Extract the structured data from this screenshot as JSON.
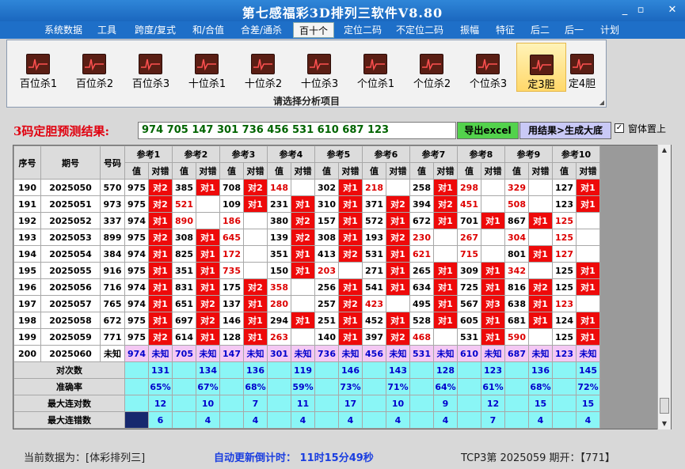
{
  "app": {
    "title": "第七感福彩3D排列三软件V8.80",
    "win_buttons": [
      "_",
      "▫",
      "✕"
    ]
  },
  "menu": {
    "items": [
      "系统数据",
      "工具",
      "跨度/复式",
      "和/合值",
      "合差/通杀",
      "百十个",
      "定位二码",
      "不定位二码",
      "振幅",
      "特征",
      "后二",
      "后一",
      "计划"
    ],
    "selected": "百十个"
  },
  "ribbon": {
    "buttons": [
      "百位杀1",
      "百位杀2",
      "百位杀3",
      "十位杀1",
      "十位杀2",
      "十位杀3",
      "个位杀1",
      "个位杀2",
      "个位杀3",
      "定3胆",
      "定4胆"
    ],
    "selected": "定3胆",
    "footer": "请选择分析项目"
  },
  "prediction": {
    "label": "3码定胆预测结果:",
    "value": "974 705 147 301 736 456 531 610 687 123",
    "excel_btn": "导出excel",
    "enlarge_btn": "用结果>生成大底",
    "topmost_label": "窗体置上",
    "topmost_check": "✓"
  },
  "grid": {
    "h_seq": "序号",
    "h_issue": "期号",
    "h_code": "号码",
    "refs": [
      "参考1",
      "参考2",
      "参考3",
      "参考4",
      "参考5",
      "参考6",
      "参考7",
      "参考8",
      "参考9",
      "参考10"
    ],
    "sub_val": "值",
    "sub_res": "对错",
    "rows": [
      {
        "seq": "190",
        "issue": "2025050",
        "code": "570",
        "cells": [
          [
            "975",
            "对2",
            1,
            0
          ],
          [
            "385",
            "对1",
            1,
            0
          ],
          [
            "708",
            "对2",
            1,
            0
          ],
          [
            "148",
            "",
            0,
            1
          ],
          [
            "302",
            "对1",
            1,
            0
          ],
          [
            "218",
            "",
            0,
            1
          ],
          [
            "258",
            "对1",
            1,
            0
          ],
          [
            "298",
            "",
            0,
            1
          ],
          [
            "329",
            "",
            0,
            1
          ],
          [
            "127",
            "对1",
            1,
            0
          ]
        ]
      },
      {
        "seq": "191",
        "issue": "2025051",
        "code": "973",
        "cells": [
          [
            "975",
            "对2",
            1,
            0
          ],
          [
            "521",
            "",
            0,
            1
          ],
          [
            "109",
            "对1",
            1,
            0
          ],
          [
            "231",
            "对1",
            1,
            0
          ],
          [
            "310",
            "对1",
            1,
            0
          ],
          [
            "371",
            "对2",
            1,
            0
          ],
          [
            "394",
            "对2",
            1,
            0
          ],
          [
            "451",
            "",
            0,
            1
          ],
          [
            "508",
            "",
            0,
            1
          ],
          [
            "123",
            "对1",
            1,
            0
          ]
        ]
      },
      {
        "seq": "192",
        "issue": "2025052",
        "code": "337",
        "cells": [
          [
            "974",
            "对1",
            1,
            0
          ],
          [
            "890",
            "",
            0,
            1
          ],
          [
            "186",
            "",
            0,
            1
          ],
          [
            "380",
            "对2",
            1,
            0
          ],
          [
            "157",
            "对1",
            1,
            0
          ],
          [
            "572",
            "对1",
            1,
            0
          ],
          [
            "672",
            "对1",
            1,
            0
          ],
          [
            "701",
            "对1",
            1,
            0
          ],
          [
            "867",
            "对1",
            1,
            0
          ],
          [
            "125",
            "",
            0,
            1
          ]
        ]
      },
      {
        "seq": "193",
        "issue": "2025053",
        "code": "899",
        "cells": [
          [
            "975",
            "对2",
            1,
            0
          ],
          [
            "308",
            "对1",
            1,
            0
          ],
          [
            "645",
            "",
            0,
            1
          ],
          [
            "139",
            "对2",
            1,
            0
          ],
          [
            "308",
            "对1",
            1,
            0
          ],
          [
            "193",
            "对2",
            1,
            0
          ],
          [
            "230",
            "",
            0,
            1
          ],
          [
            "267",
            "",
            0,
            1
          ],
          [
            "304",
            "",
            0,
            1
          ],
          [
            "125",
            "",
            0,
            1
          ]
        ]
      },
      {
        "seq": "194",
        "issue": "2025054",
        "code": "384",
        "cells": [
          [
            "974",
            "对1",
            1,
            0
          ],
          [
            "825",
            "对1",
            1,
            0
          ],
          [
            "172",
            "",
            0,
            1
          ],
          [
            "351",
            "对1",
            1,
            0
          ],
          [
            "413",
            "对2",
            1,
            0
          ],
          [
            "531",
            "对1",
            1,
            0
          ],
          [
            "621",
            "",
            0,
            1
          ],
          [
            "715",
            "",
            0,
            1
          ],
          [
            "801",
            "对1",
            1,
            0
          ],
          [
            "127",
            "",
            0,
            1
          ]
        ]
      },
      {
        "seq": "195",
        "issue": "2025055",
        "code": "916",
        "cells": [
          [
            "975",
            "对1",
            1,
            0
          ],
          [
            "351",
            "对1",
            1,
            0
          ],
          [
            "735",
            "",
            0,
            1
          ],
          [
            "150",
            "对1",
            1,
            0
          ],
          [
            "203",
            "",
            0,
            1
          ],
          [
            "271",
            "对1",
            1,
            0
          ],
          [
            "265",
            "对1",
            1,
            0
          ],
          [
            "309",
            "对1",
            1,
            0
          ],
          [
            "342",
            "",
            0,
            1
          ],
          [
            "125",
            "对1",
            1,
            0
          ]
        ]
      },
      {
        "seq": "196",
        "issue": "2025056",
        "code": "716",
        "cells": [
          [
            "974",
            "对1",
            1,
            0
          ],
          [
            "831",
            "对1",
            1,
            0
          ],
          [
            "175",
            "对2",
            1,
            0
          ],
          [
            "358",
            "",
            0,
            1
          ],
          [
            "256",
            "对1",
            1,
            0
          ],
          [
            "541",
            "对1",
            1,
            0
          ],
          [
            "634",
            "对1",
            1,
            0
          ],
          [
            "725",
            "对1",
            1,
            0
          ],
          [
            "816",
            "对2",
            1,
            0
          ],
          [
            "125",
            "对1",
            1,
            0
          ]
        ]
      },
      {
        "seq": "197",
        "issue": "2025057",
        "code": "765",
        "cells": [
          [
            "974",
            "对1",
            1,
            0
          ],
          [
            "651",
            "对2",
            1,
            0
          ],
          [
            "137",
            "对1",
            1,
            0
          ],
          [
            "280",
            "",
            0,
            1
          ],
          [
            "257",
            "对2",
            1,
            0
          ],
          [
            "423",
            "",
            0,
            1
          ],
          [
            "495",
            "对1",
            1,
            0
          ],
          [
            "567",
            "对3",
            1,
            0
          ],
          [
            "638",
            "对1",
            1,
            0
          ],
          [
            "123",
            "",
            0,
            1
          ]
        ]
      },
      {
        "seq": "198",
        "issue": "2025058",
        "code": "672",
        "cells": [
          [
            "975",
            "对1",
            1,
            0
          ],
          [
            "697",
            "对2",
            1,
            0
          ],
          [
            "146",
            "对1",
            1,
            0
          ],
          [
            "294",
            "对1",
            1,
            0
          ],
          [
            "251",
            "对1",
            1,
            0
          ],
          [
            "452",
            "对1",
            1,
            0
          ],
          [
            "528",
            "对1",
            1,
            0
          ],
          [
            "605",
            "对1",
            1,
            0
          ],
          [
            "681",
            "对1",
            1,
            0
          ],
          [
            "124",
            "对1",
            1,
            0
          ]
        ]
      },
      {
        "seq": "199",
        "issue": "2025059",
        "code": "771",
        "cells": [
          [
            "975",
            "对2",
            1,
            0
          ],
          [
            "614",
            "对1",
            1,
            0
          ],
          [
            "128",
            "对1",
            1,
            0
          ],
          [
            "263",
            "",
            0,
            1
          ],
          [
            "140",
            "对1",
            1,
            0
          ],
          [
            "397",
            "对2",
            1,
            0
          ],
          [
            "468",
            "",
            0,
            1
          ],
          [
            "531",
            "对1",
            1,
            0
          ],
          [
            "590",
            "",
            0,
            1
          ],
          [
            "125",
            "对1",
            1,
            0
          ]
        ]
      }
    ],
    "pending": {
      "seq": "200",
      "issue": "2025060",
      "code": "未知",
      "vals": [
        "974",
        "705",
        "147",
        "301",
        "736",
        "456",
        "531",
        "610",
        "687",
        "123"
      ],
      "unknown": "未知"
    },
    "stats": [
      {
        "label": "对次数",
        "vals": [
          "131",
          "134",
          "136",
          "119",
          "146",
          "143",
          "128",
          "123",
          "136",
          "145"
        ]
      },
      {
        "label": "准确率",
        "vals": [
          "65%",
          "67%",
          "68%",
          "59%",
          "73%",
          "71%",
          "64%",
          "61%",
          "68%",
          "72%"
        ]
      },
      {
        "label": "最大连对数",
        "vals": [
          "12",
          "10",
          "7",
          "11",
          "17",
          "10",
          "9",
          "12",
          "15",
          "15"
        ]
      },
      {
        "label": "最大连错数",
        "vals": [
          "6",
          "4",
          "4",
          "4",
          "4",
          "4",
          "4",
          "7",
          "4",
          "4"
        ]
      }
    ]
  },
  "status": {
    "current": "当前数据为：[体彩排列三]",
    "countdown": "自动更新倒计时：  11时15分49秒",
    "period": "TCP3第 2025059 期开：【771】"
  }
}
